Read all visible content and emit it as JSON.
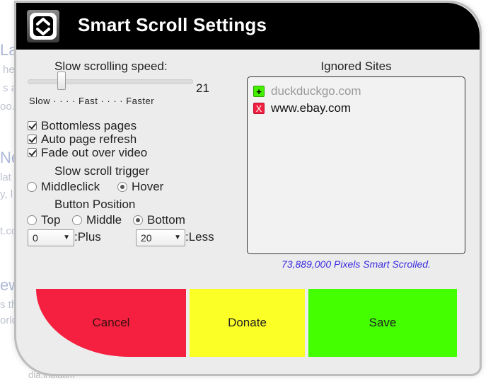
{
  "dialog": {
    "title": "Smart Scroll Settings",
    "logo_icon": "smart-scroll-logo-icon"
  },
  "speed": {
    "label": "Slow scrolling speed:",
    "value": "21",
    "scale_label": "Slow · · · · Fast · · · · Faster"
  },
  "options": {
    "bottomless": {
      "label": "Bottomless pages",
      "checked": true
    },
    "auto_refresh": {
      "label": "Auto page refresh",
      "checked": true
    },
    "fade_video": {
      "label": "Fade out over video",
      "checked": true
    }
  },
  "trigger": {
    "label": "Slow scroll trigger",
    "options": [
      "Middleclick",
      "Hover"
    ],
    "selected": "Hover"
  },
  "position": {
    "label": "Button Position",
    "options": [
      "Top",
      "Middle",
      "Bottom"
    ],
    "selected": "Bottom"
  },
  "offsets": {
    "plus_value": "0",
    "plus_label": ":Plus",
    "less_value": "20",
    "less_label": ":Less"
  },
  "ignored_sites": {
    "label": "Ignored Sites",
    "add_placeholder": "duckduckgo.com",
    "add_badge": "+",
    "remove_badge": "X",
    "sites": [
      "www.ebay.com"
    ]
  },
  "stats": {
    "pixels_scrolled": "73,889,000 Pixels Smart Scrolled."
  },
  "buttons": {
    "cancel": "Cancel",
    "donate": "Donate",
    "save": "Save"
  },
  "colors": {
    "title_bar": "#000000",
    "cancel": "#f5203f",
    "donate": "#fcff26",
    "save": "#44ff00",
    "stats_text": "#3a2ae0"
  }
}
